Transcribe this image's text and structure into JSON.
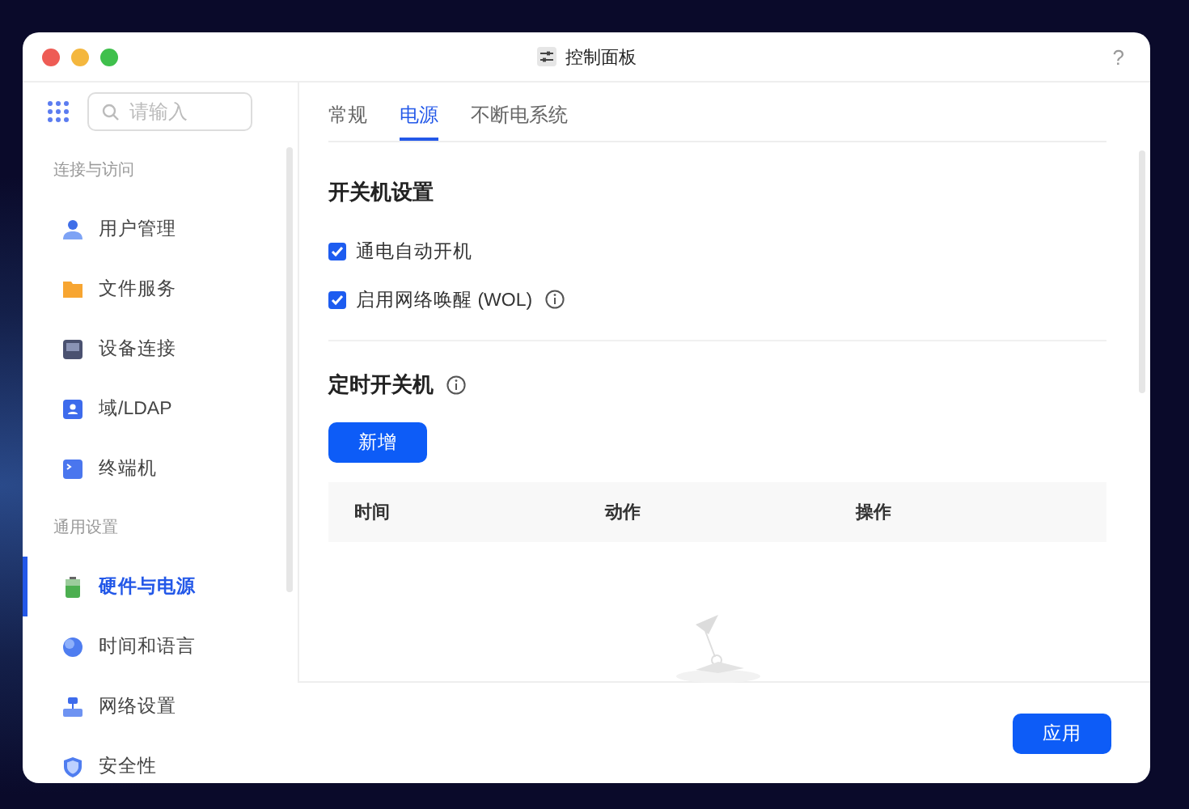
{
  "window": {
    "title": "控制面板",
    "help": "?"
  },
  "sidebar": {
    "search": {
      "placeholder": "请输入"
    },
    "sections": [
      {
        "title": "连接与访问",
        "items": [
          {
            "label": "用户管理",
            "selected": false
          },
          {
            "label": "文件服务",
            "selected": false
          },
          {
            "label": "设备连接",
            "selected": false
          },
          {
            "label": "域/LDAP",
            "selected": false
          },
          {
            "label": "终端机",
            "selected": false
          }
        ]
      },
      {
        "title": "通用设置",
        "items": [
          {
            "label": "硬件与电源",
            "selected": true
          },
          {
            "label": "时间和语言",
            "selected": false
          },
          {
            "label": "网络设置",
            "selected": false
          },
          {
            "label": "安全性",
            "selected": false
          }
        ]
      }
    ]
  },
  "tabs": [
    {
      "label": "常规",
      "selected": false
    },
    {
      "label": "电源",
      "selected": true
    },
    {
      "label": "不断电系统",
      "selected": false
    }
  ],
  "power_settings": {
    "title": "开关机设置",
    "options": [
      {
        "label": "通电自动开机",
        "checked": true,
        "info": false
      },
      {
        "label": "启用网络唤醒 (WOL)",
        "checked": true,
        "info": true
      }
    ]
  },
  "schedule": {
    "title": "定时开关机",
    "add_button": "新增",
    "table": {
      "columns": [
        "时间",
        "动作",
        "操作"
      ]
    }
  },
  "footer": {
    "apply_button": "应用"
  }
}
